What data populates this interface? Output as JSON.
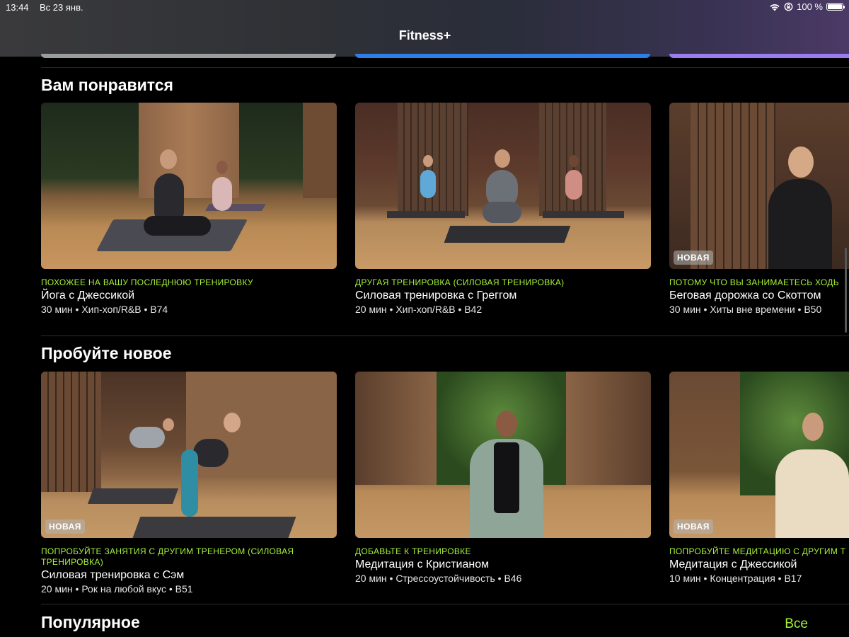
{
  "status_bar": {
    "time": "13:44",
    "date": "Вс 23 янв.",
    "battery": "100 %",
    "battery_level": 1.0
  },
  "header": {
    "apple_glyph": "",
    "title": "Fitness+"
  },
  "sections": [
    {
      "title": "Вам понравится",
      "cards": [
        {
          "eyebrow": "ПОХОЖЕЕ НА ВАШУ ПОСЛЕДНЮЮ ТРЕНИРОВКУ",
          "title": "Йога с Джессикой",
          "meta": "30 мин • Хип-хоп/R&B • B74",
          "badge": ""
        },
        {
          "eyebrow": "ДРУГАЯ ТРЕНИРОВКА (СИЛОВАЯ ТРЕНИРОВКА)",
          "title": "Силовая тренировка с Греггом",
          "meta": "20 мин • Хип-хоп/R&B • B42",
          "badge": ""
        },
        {
          "eyebrow": "ПОТОМУ ЧТО ВЫ ЗАНИМАЕТЕСЬ ХОДЬ",
          "title": "Беговая дорожка со Скоттом",
          "meta": "30 мин • Хиты вне времени • B50",
          "badge": "НОВАЯ"
        }
      ]
    },
    {
      "title": "Пробуйте новое",
      "cards": [
        {
          "eyebrow": "ПОПРОБУЙТЕ ЗАНЯТИЯ С ДРУГИМ ТРЕНЕРОМ (СИЛОВАЯ ТРЕНИРОВКА)",
          "title": "Силовая тренировка с Сэм",
          "meta": "20 мин • Рок на любой вкус • B51",
          "badge": "НОВАЯ"
        },
        {
          "eyebrow": "ДОБАВЬТЕ К ТРЕНИРОВКЕ",
          "title": "Медитация с Кристианом",
          "meta": "20 мин • Стрессоустойчивость • B46",
          "badge": ""
        },
        {
          "eyebrow": "ПОПРОБУЙТЕ МЕДИТАЦИЮ С ДРУГИМ Т",
          "title": "Медитация с Джессикой",
          "meta": "10 мин • Концентрация • B17",
          "badge": "НОВАЯ"
        }
      ]
    },
    {
      "title": "Популярное",
      "see_all": "Все"
    }
  ],
  "colors": {
    "accent": "#a6f23a",
    "background": "#000000",
    "peek_bar_1": "#9a9d9e",
    "peek_bar_2": "#2c7fe6",
    "peek_bar_3": "#9b7cf0"
  }
}
